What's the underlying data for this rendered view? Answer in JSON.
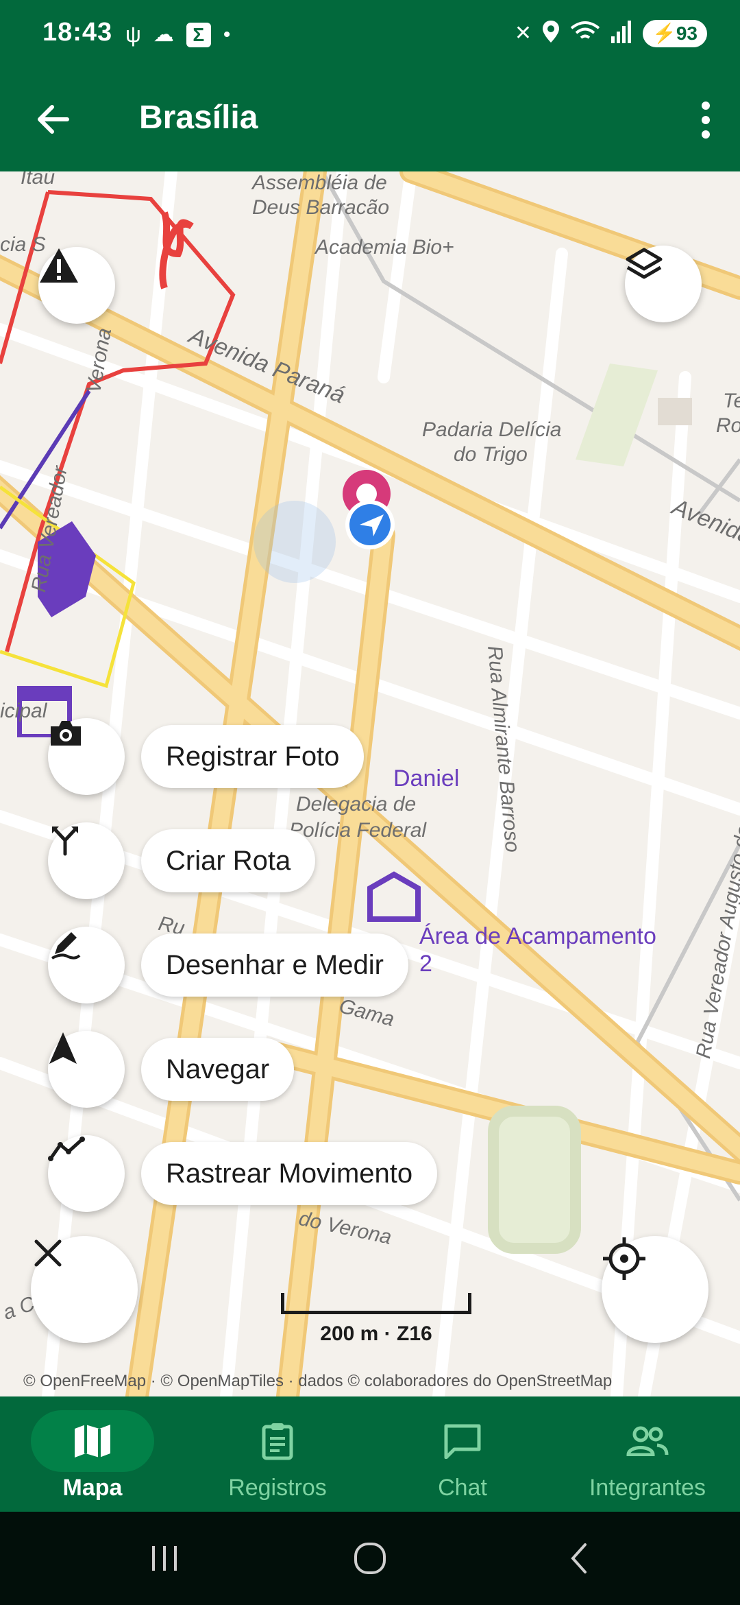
{
  "status_bar": {
    "time": "18:43",
    "battery": "93"
  },
  "app_bar": {
    "title": "Brasília"
  },
  "map": {
    "streets": [
      "Itaú",
      "Assembléia de",
      "Deus Barracão",
      "Academia Bio+",
      "Avenida Paraná",
      "Verona",
      "Rua Vereador",
      "Padaria Delícia",
      "do Trigo",
      "Avenida",
      "Rua Almirante Barroso",
      "Rua Vereador Augusto dos Santos",
      "icipal",
      "Delegacia de",
      "Polícia Federal",
      "Gama",
      "do Verona",
      "Te",
      "Ro",
      "a Co",
      "cia S",
      "Ru"
    ],
    "poi": [
      {
        "label": "Daniel"
      },
      {
        "label": "Área de Acampamento"
      },
      {
        "label": "2"
      }
    ],
    "scale": "200 m · Z16",
    "attribution": "© OpenFreeMap · © OpenMapTiles · dados © colaboradores do OpenStreetMap"
  },
  "fab_menu": [
    {
      "label": "Registrar Foto",
      "icon": "camera-icon"
    },
    {
      "label": "Criar Rota",
      "icon": "route-split-icon"
    },
    {
      "label": "Desenhar e Medir",
      "icon": "draw-measure-icon"
    },
    {
      "label": "Navegar",
      "icon": "navigation-arrow-icon"
    },
    {
      "label": "Rastrear Movimento",
      "icon": "track-line-icon"
    }
  ],
  "bottom_nav": [
    {
      "label": "Mapa",
      "icon": "map-icon",
      "active": true
    },
    {
      "label": "Registros",
      "icon": "clipboard-icon",
      "active": false
    },
    {
      "label": "Chat",
      "icon": "chat-icon",
      "active": false
    },
    {
      "label": "Integrantes",
      "icon": "people-icon",
      "active": false
    }
  ],
  "colors": {
    "primary": "#02693c",
    "route_red": "#e8413e",
    "route_purple": "#5b3bb5",
    "route_yellow": "#f5e23a",
    "road_yellow": "#f7d98c"
  }
}
